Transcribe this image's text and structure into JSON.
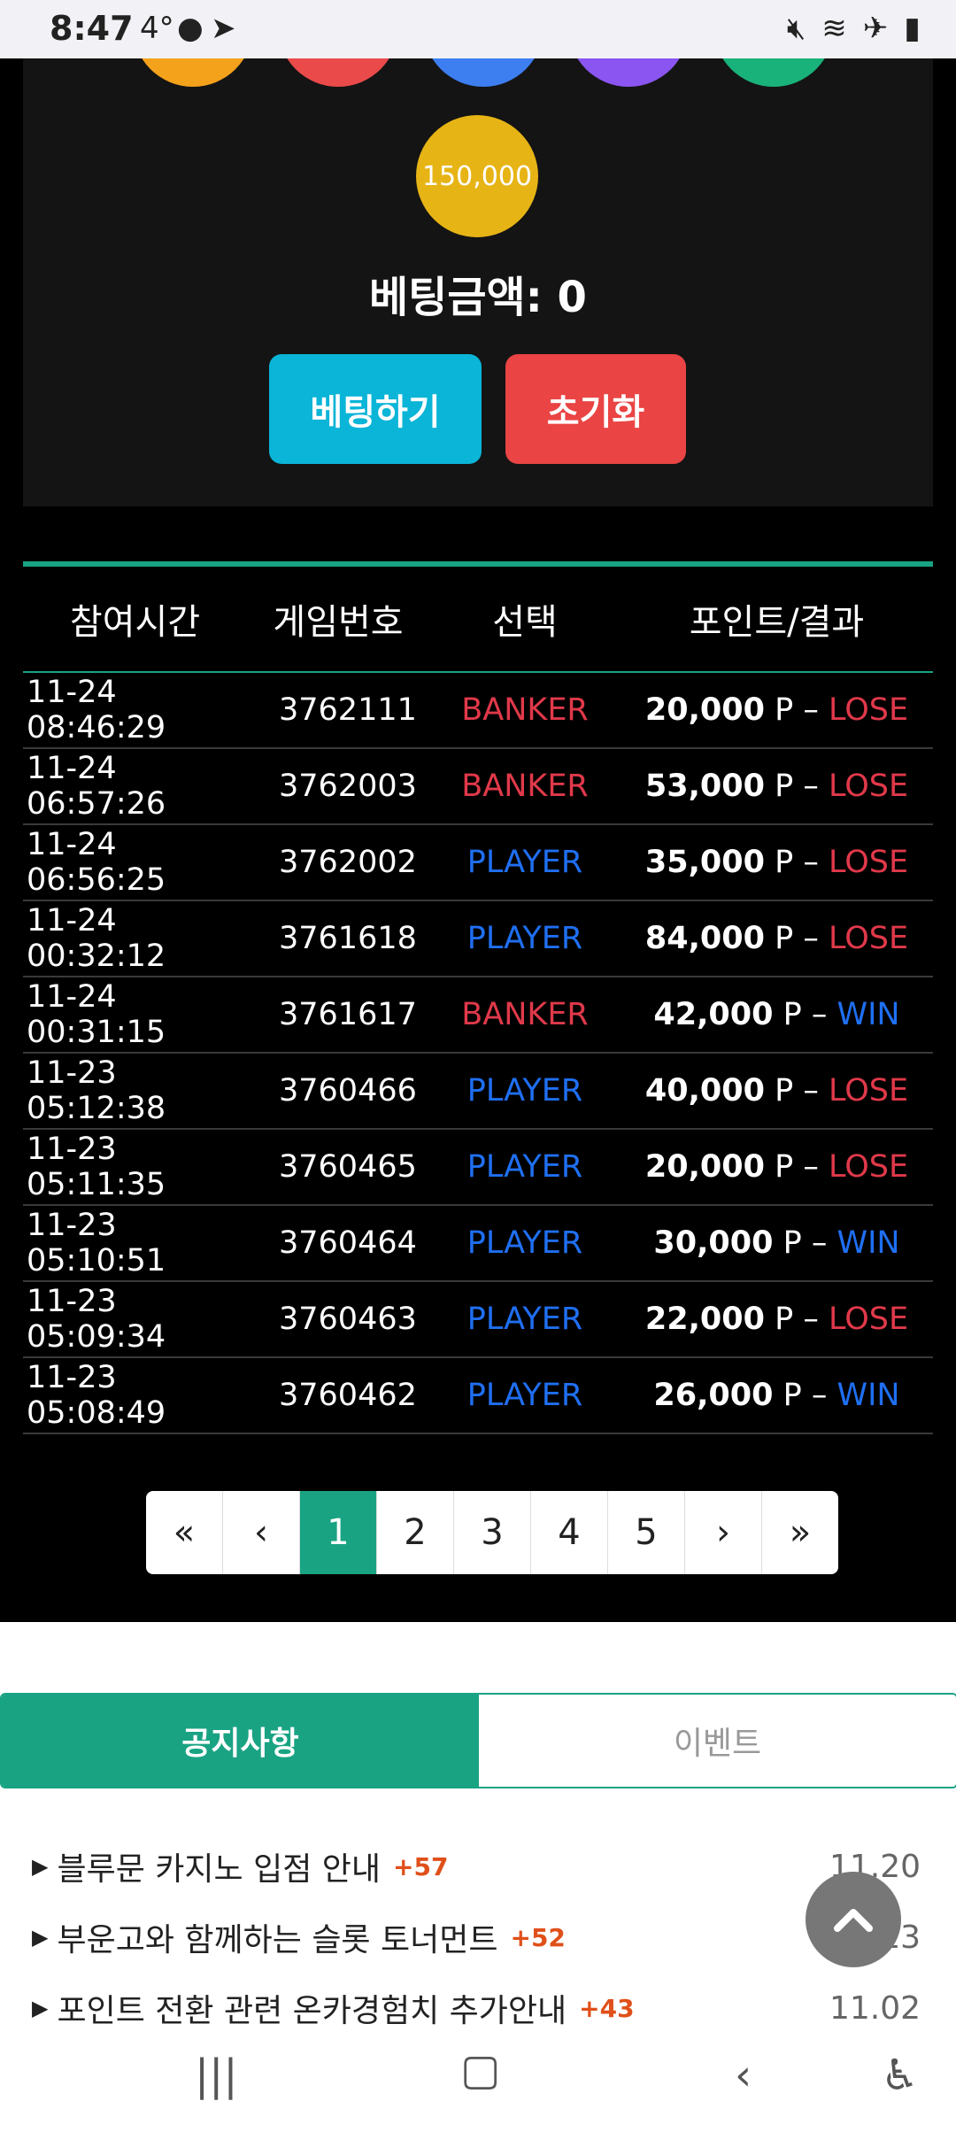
{
  "status_bar": {
    "time": "8:47",
    "notification_count": "4°",
    "icons": [
      "chat-icon",
      "telegram-icon",
      "mute-icon",
      "wifi-icon",
      "airplane-icon",
      "battery-icon"
    ]
  },
  "bet_panel": {
    "chip_colors": [
      "#f4a11c",
      "#ea4a4a",
      "#3d7ef0",
      "#8a55f0",
      "#19b27a"
    ],
    "selected_chip_value": "150,000",
    "bet_amount_label": "베팅금액: 0",
    "bet_button": "베팅하기",
    "reset_button": "초기화"
  },
  "history": {
    "columns": [
      "참여시간",
      "게임번호",
      "선택",
      "포인트/결과"
    ],
    "rows": [
      {
        "time": "11-24 08:46:29",
        "game": "3762111",
        "choice": "BANKER",
        "points": "20,000",
        "unit": "P",
        "result": "LOSE"
      },
      {
        "time": "11-24 06:57:26",
        "game": "3762003",
        "choice": "BANKER",
        "points": "53,000",
        "unit": "P",
        "result": "LOSE"
      },
      {
        "time": "11-24 06:56:25",
        "game": "3762002",
        "choice": "PLAYER",
        "points": "35,000",
        "unit": "P",
        "result": "LOSE"
      },
      {
        "time": "11-24 00:32:12",
        "game": "3761618",
        "choice": "PLAYER",
        "points": "84,000",
        "unit": "P",
        "result": "LOSE"
      },
      {
        "time": "11-24 00:31:15",
        "game": "3761617",
        "choice": "BANKER",
        "points": "42,000",
        "unit": "P",
        "result": "WIN"
      },
      {
        "time": "11-23 05:12:38",
        "game": "3760466",
        "choice": "PLAYER",
        "points": "40,000",
        "unit": "P",
        "result": "LOSE"
      },
      {
        "time": "11-23 05:11:35",
        "game": "3760465",
        "choice": "PLAYER",
        "points": "20,000",
        "unit": "P",
        "result": "LOSE"
      },
      {
        "time": "11-23 05:10:51",
        "game": "3760464",
        "choice": "PLAYER",
        "points": "30,000",
        "unit": "P",
        "result": "WIN"
      },
      {
        "time": "11-23 05:09:34",
        "game": "3760463",
        "choice": "PLAYER",
        "points": "22,000",
        "unit": "P",
        "result": "LOSE"
      },
      {
        "time": "11-23 05:08:49",
        "game": "3760462",
        "choice": "PLAYER",
        "points": "26,000",
        "unit": "P",
        "result": "WIN"
      }
    ]
  },
  "pagination": {
    "first": "«",
    "prev": "‹",
    "pages": [
      "1",
      "2",
      "3",
      "4",
      "5"
    ],
    "active_page": "1",
    "next": "›",
    "last": "»"
  },
  "notices": {
    "tabs": [
      {
        "label": "공지사항",
        "active": true
      },
      {
        "label": "이벤트",
        "active": false
      }
    ],
    "items": [
      {
        "title": "블루문 카지노 입점 안내",
        "count": "+57",
        "date": "11.20"
      },
      {
        "title": "부운고와 함께하는 슬롯 토너먼트",
        "count": "+52",
        "date": "11.13"
      },
      {
        "title": "포인트 전환 관련 온카경험치 추가안내",
        "count": "+43",
        "date": "11.02"
      }
    ]
  },
  "colors": {
    "accent": "#19a383",
    "banker": "#e0394a",
    "player": "#1f6ff2",
    "bet_button": "#0ab5d7",
    "reset_button": "#ea4444",
    "chip_main": "#e7b416"
  }
}
